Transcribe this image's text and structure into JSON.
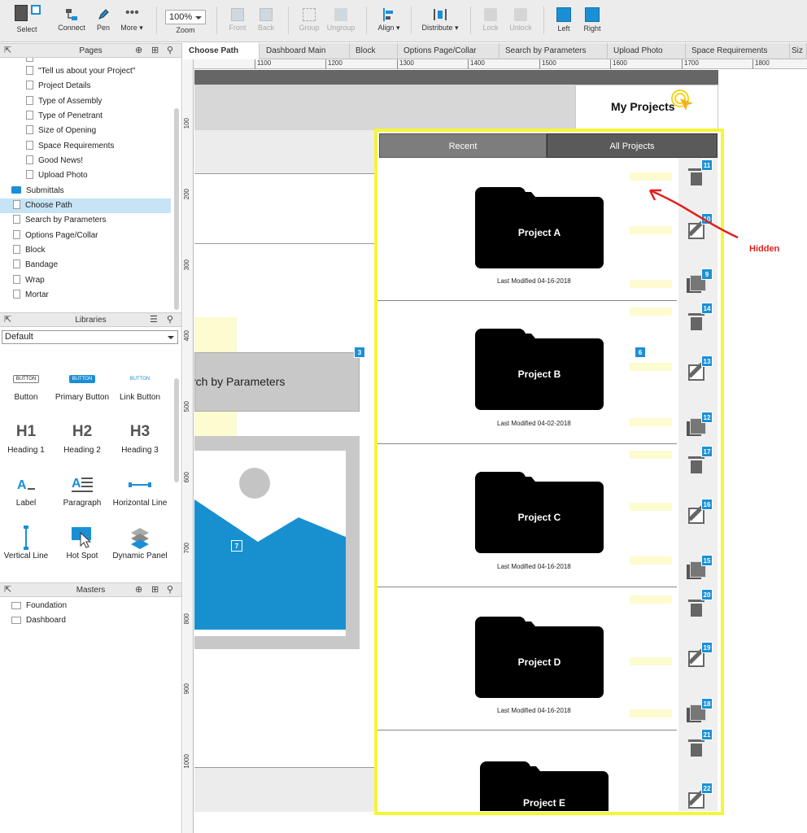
{
  "toolbar": {
    "select": "Select",
    "connect": "Connect",
    "pen": "Pen",
    "more": "More ▾",
    "zoom_value": "100%",
    "zoom": "Zoom",
    "front": "Front",
    "back": "Back",
    "group": "Group",
    "ungroup": "Ungroup",
    "align": "Align ▾",
    "distribute": "Distribute ▾",
    "lock": "Lock",
    "unlock": "Unlock",
    "left": "Left",
    "right": "Right"
  },
  "pages": {
    "title": "Pages",
    "items": [
      "\"Tell us about your Project\"",
      "Project Details",
      "Type of Assembly",
      "Type of Penetrant",
      "Size of Opening",
      "Space Requirements",
      "Good News!",
      "Upload Photo",
      "Submittals",
      "Choose Path",
      "Search by Parameters",
      "Options Page/Collar",
      "Block",
      "Bandage",
      "Wrap",
      "Mortar"
    ]
  },
  "libraries": {
    "title": "Libraries",
    "selected": "Default",
    "widgets": [
      "Button",
      "Primary Button",
      "Link Button",
      "Heading 1",
      "Heading 2",
      "Heading 3",
      "Label",
      "Paragraph",
      "Horizontal Line",
      "Vertical Line",
      "Hot Spot",
      "Dynamic Panel"
    ],
    "widget_icons": {
      "button": "BUTTON",
      "h1": "H1",
      "h2": "H2",
      "h3": "H3"
    }
  },
  "masters": {
    "title": "Masters",
    "items": [
      "Foundation",
      "Dashboard"
    ]
  },
  "tabs": [
    "Choose Path",
    "Dashboard Main",
    "Block",
    "Options Page/Collar",
    "Search by Parameters",
    "Upload Photo",
    "Space Requirements",
    "Siz"
  ],
  "ruler": {
    "h": [
      "1100",
      "1200",
      "1300",
      "1400",
      "1500",
      "1600",
      "1700",
      "1800"
    ],
    "v": [
      "100",
      "200",
      "300",
      "400",
      "500",
      "600",
      "700",
      "800",
      "900",
      "1000"
    ]
  },
  "canvas": {
    "my_projects": "My Projects",
    "search_by_parameters": "rch by Parameters",
    "tab_recent": "Recent",
    "tab_all": "All Projects",
    "annotation": "Hidden",
    "badge_search": "3",
    "badge_image": "7",
    "badge_mid": "6",
    "projects": [
      {
        "name": "Project A",
        "modified": "Last Modified 04-16-2018",
        "b_trash": "11",
        "b_edit": "10",
        "b_copy": "9"
      },
      {
        "name": "Project B",
        "modified": "Last Modified 04-02-2018",
        "b_trash": "14",
        "b_edit": "13",
        "b_copy": "12"
      },
      {
        "name": "Project C",
        "modified": "Last Modified 04-16-2018",
        "b_trash": "17",
        "b_edit": "16",
        "b_copy": "15"
      },
      {
        "name": "Project D",
        "modified": "Last Modified 04-16-2018",
        "b_trash": "20",
        "b_edit": "19",
        "b_copy": "18"
      },
      {
        "name": "Project E",
        "b_trash": "21",
        "b_edit": "22"
      }
    ],
    "colors": {
      "highlight": "#f5f53a",
      "annotation": "#e0211e",
      "badge": "#1b90d5",
      "image_fill": "#1890d0"
    }
  }
}
